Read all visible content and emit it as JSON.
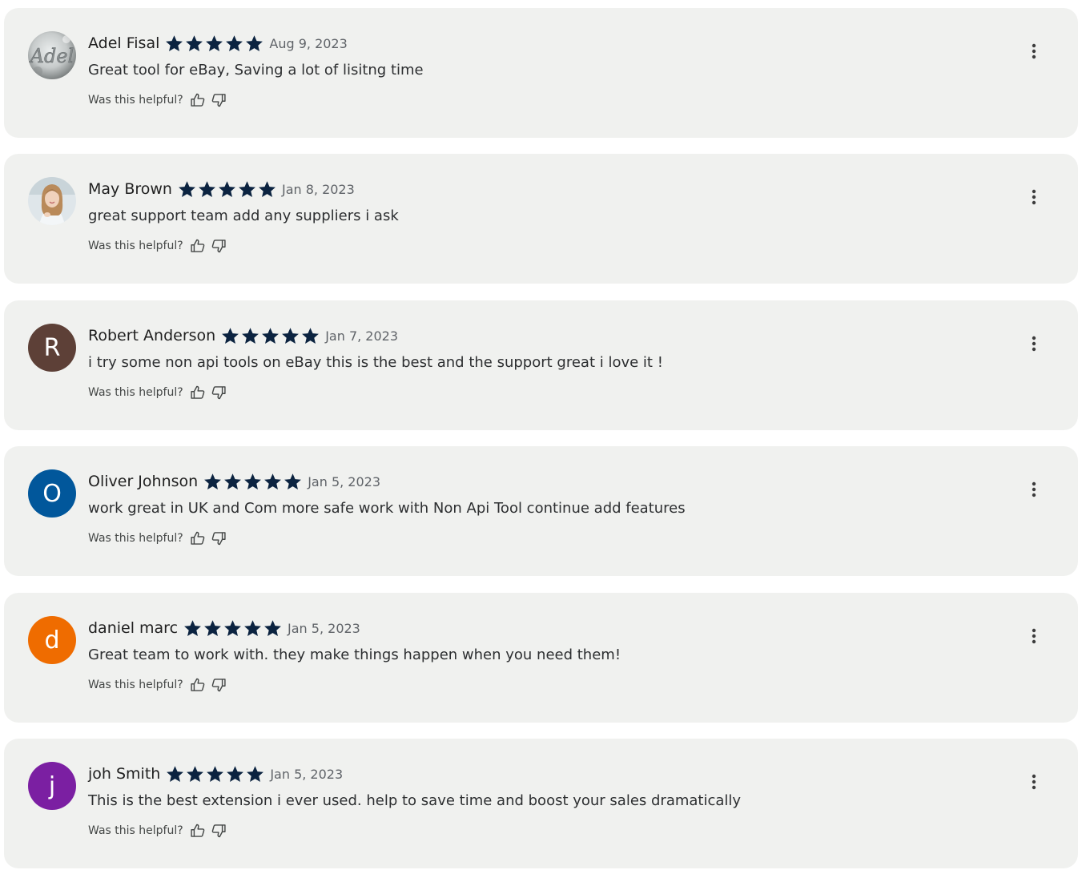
{
  "helpful_prompt": "Was this helpful?",
  "star_color": "#0b2340",
  "reviews": [
    {
      "author": "Adel Fisal",
      "date": "Aug 9, 2023",
      "rating": 5,
      "text": "Great tool for eBay, Saving a lot of lisitng time",
      "avatar": {
        "type": "photo",
        "icon": "adel-handwriting-photo",
        "label": "Adel"
      }
    },
    {
      "author": "May Brown",
      "date": "Jan 8, 2023",
      "rating": 5,
      "text": "great support team add any suppliers i ask",
      "avatar": {
        "type": "photo",
        "icon": "woman-portrait-photo"
      }
    },
    {
      "author": "Robert Anderson",
      "date": "Jan 7, 2023",
      "rating": 5,
      "text": "i try some non api tools on eBay this is the best and the support great i love it !",
      "avatar": {
        "type": "letter",
        "letter": "R",
        "color": "#5d4037"
      }
    },
    {
      "author": "Oliver Johnson",
      "date": "Jan 5, 2023",
      "rating": 5,
      "text": "work great in UK and Com more safe work with Non Api Tool continue add features",
      "avatar": {
        "type": "letter",
        "letter": "O",
        "color": "#01579b"
      }
    },
    {
      "author": "daniel marc",
      "date": "Jan 5, 2023",
      "rating": 5,
      "text": "Great team to work with. they make things happen when you need them!",
      "avatar": {
        "type": "letter",
        "letter": "d",
        "color": "#ef6c00"
      }
    },
    {
      "author": "joh Smith",
      "date": "Jan 5, 2023",
      "rating": 5,
      "text": "This is the best extension i ever used. help to save time and boost your sales dramatically",
      "avatar": {
        "type": "letter",
        "letter": "j",
        "color": "#7b1fa2"
      }
    }
  ]
}
